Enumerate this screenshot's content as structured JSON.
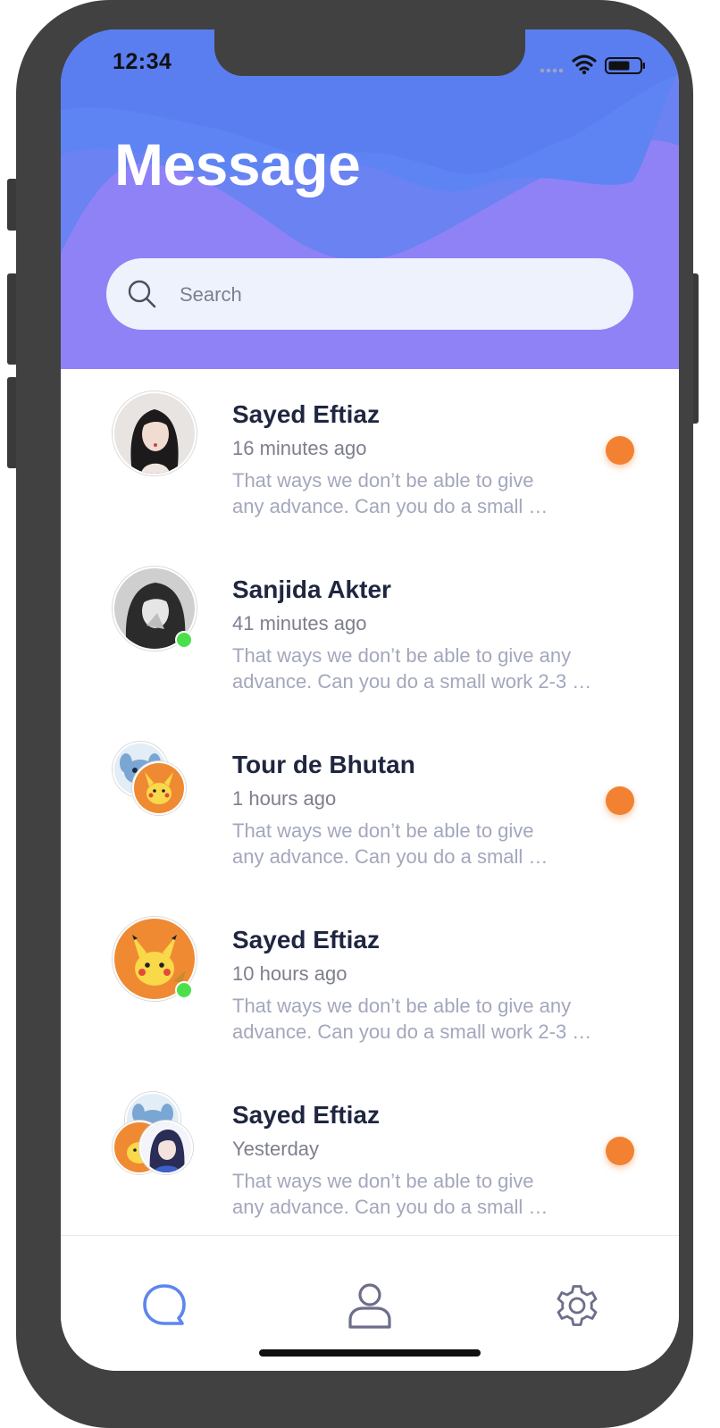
{
  "status_bar": {
    "time": "12:34"
  },
  "header": {
    "title": "Message"
  },
  "search": {
    "placeholder": "Search"
  },
  "conversations": [
    {
      "name": "Sayed Eftiaz",
      "time": "16 minutes ago",
      "preview_line1": "That ways we don’t be able to give",
      "preview_line2": "any advance. Can you do a small …",
      "unread": true,
      "online": false
    },
    {
      "name": "Sanjida Akter",
      "time": "41 minutes ago",
      "preview_line1": "That ways we don’t be able to give any",
      "preview_line2": "advance. Can you do a small work 2-3 …",
      "unread": false,
      "online": true
    },
    {
      "name": "Tour de Bhutan",
      "time": "1 hours ago",
      "preview_line1": "That ways we don’t be able to give",
      "preview_line2": "any advance. Can you do a small …",
      "unread": true,
      "online": false
    },
    {
      "name": "Sayed Eftiaz",
      "time": "10 hours ago",
      "preview_line1": "That ways we don’t be able to give any",
      "preview_line2": "advance. Can you do a small work 2-3 …",
      "unread": false,
      "online": true
    },
    {
      "name": "Sayed Eftiaz",
      "time": "Yesterday",
      "preview_line1": "That ways we don’t be able to give",
      "preview_line2": "any advance. Can you do a small …",
      "unread": true,
      "online": false
    }
  ],
  "tabs": [
    {
      "icon": "chat-bubble-icon",
      "active": true
    },
    {
      "icon": "user-icon",
      "active": false
    },
    {
      "icon": "gear-icon",
      "active": false
    }
  ],
  "colors": {
    "header_top": "#5b7ff0",
    "header_bottom": "#8f82f6",
    "unread_dot": "#f28231",
    "online_dot": "#4be04b",
    "tab_active": "#5d86ee",
    "tab_inactive": "#6d6e8a"
  }
}
